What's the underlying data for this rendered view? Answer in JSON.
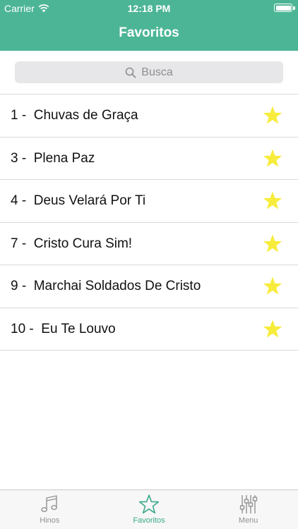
{
  "status_bar": {
    "carrier": "Carrier",
    "time": "12:18 PM"
  },
  "nav": {
    "title": "Favoritos"
  },
  "search": {
    "placeholder": "Busca"
  },
  "favorites": [
    {
      "label": "1 -  Chuvas de Graça"
    },
    {
      "label": "3 -  Plena Paz"
    },
    {
      "label": "4 -  Deus Velará Por Ti"
    },
    {
      "label": "7 -  Cristo Cura Sim!"
    },
    {
      "label": "9 -  Marchai Soldados De Cristo"
    },
    {
      "label": "10 -  Eu Te Louvo"
    }
  ],
  "tabs": [
    {
      "label": "Hinos",
      "icon": "music-note-icon"
    },
    {
      "label": "Favoritos",
      "icon": "star-icon",
      "active": true
    },
    {
      "label": "Menu",
      "icon": "sliders-icon"
    }
  ],
  "colors": {
    "header": "#4cb595",
    "star": "#f7ec3c",
    "active_tab": "#3aa88a",
    "inactive_tab": "#929292"
  }
}
